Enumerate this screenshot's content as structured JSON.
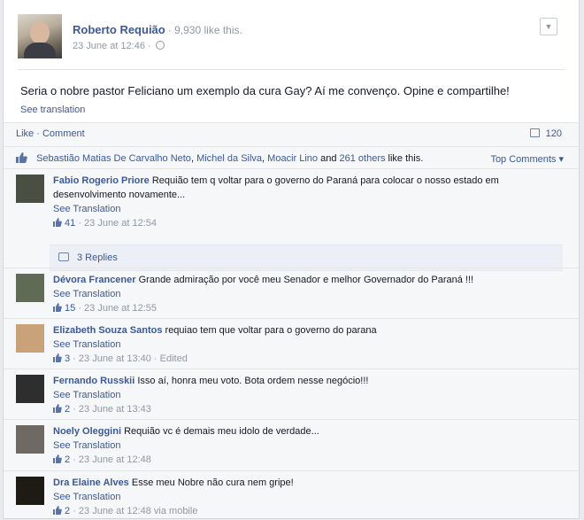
{
  "post": {
    "author": "Roberto Requião",
    "like_summary": "· 9,930 like this.",
    "timestamp": "23 June at 12:46 ·",
    "text": "Seria o nobre pastor Feliciano um exemplo da cura Gay? Aí me convenço. Opine e compartilhe!",
    "see_translation": "See translation",
    "menu_icon": "chevron-down-icon",
    "privacy_icon": "globe-icon"
  },
  "feedback": {
    "like_label": "Like",
    "separator": "·",
    "comment_label": "Comment",
    "comment_count": "120",
    "likers": [
      "Sebastião Matias De Carvalho Neto",
      "Michel da Silva",
      "Moacir Lino"
    ],
    "others_link": "261 others",
    "and_text": " and ",
    "like_suffix": " like this.",
    "comma": ", ",
    "top_comments": "Top Comments ▾"
  },
  "comments": [
    {
      "author": "Fabio Rogerio Priore",
      "text": "Requião tem q voltar para o governo do Paraná para colocar o nosso estado em desenvolvimento novamente...",
      "translate": "See Translation",
      "likes": "41",
      "meta": "· 23 June at 12:54",
      "replies": "3 Replies",
      "avatar_color": "#4a4f44"
    },
    {
      "author": "Dévora Francener",
      "text": "Grande admiração por você meu Senador e melhor Governador do Paraná !!!",
      "translate": "See Translation",
      "likes": "15",
      "meta": "· 23 June at 12:55",
      "avatar_color": "#5f6b55"
    },
    {
      "author": "Elizabeth Souza Santos",
      "text": "requiao tem que voltar para o governo do parana",
      "translate": "See Translation",
      "likes": "3",
      "meta": "· 23 June at 13:40 · Edited",
      "avatar_color": "#c9a27a"
    },
    {
      "author": "Fernando Russkii",
      "text": "Isso aí, honra meu voto. Bota ordem nesse negócio!!!",
      "translate": "See Translation",
      "likes": "2",
      "meta": "· 23 June at 13:43",
      "avatar_color": "#2e2e2e"
    },
    {
      "author": "Noely Oleggini",
      "text": "Requião vc é demais meu idolo de verdade...",
      "translate": "See Translation",
      "likes": "2",
      "meta": "· 23 June at 12:48",
      "avatar_color": "#6e6a63"
    },
    {
      "author": "Dra Elaine Alves",
      "text": "Esse meu Nobre não cura nem gripe!",
      "translate": "See Translation",
      "likes": "2",
      "meta": "· 23 June at 12:48 via mobile",
      "avatar_color": "#1e1a14"
    }
  ]
}
